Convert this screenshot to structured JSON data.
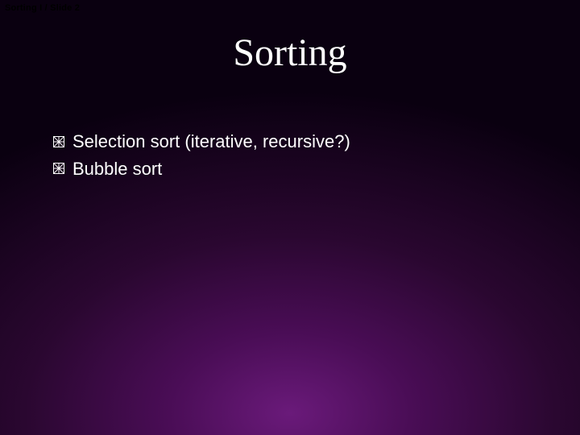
{
  "header": {
    "text": "Sorting I  / Slide 2"
  },
  "title": "Sorting",
  "bullets": [
    {
      "text": "Selection sort  (iterative, recursive?)"
    },
    {
      "text": "Bubble sort"
    }
  ]
}
